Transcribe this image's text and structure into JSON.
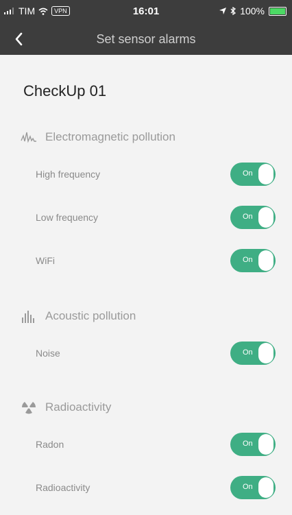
{
  "status_bar": {
    "carrier": "TIM",
    "vpn": "VPN",
    "time": "16:01",
    "battery": "100%"
  },
  "header": {
    "title": "Set sensor alarms"
  },
  "device": {
    "name": "CheckUp 01"
  },
  "sections": {
    "electromagnetic": {
      "title": "Electromagnetic pollution",
      "icon": "waveform-icon",
      "items": [
        {
          "label": "High frequency",
          "toggle": "On"
        },
        {
          "label": "Low frequency",
          "toggle": "On"
        },
        {
          "label": "WiFi",
          "toggle": "On"
        }
      ]
    },
    "acoustic": {
      "title": "Acoustic pollution",
      "icon": "sound-bars-icon",
      "items": [
        {
          "label": "Noise",
          "toggle": "On"
        }
      ]
    },
    "radioactivity": {
      "title": "Radioactivity",
      "icon": "radiation-icon",
      "items": [
        {
          "label": "Radon",
          "toggle": "On"
        },
        {
          "label": "Radioactivity",
          "toggle": "On"
        }
      ]
    }
  },
  "colors": {
    "accent": "#3fae84",
    "bar_background": "#3d3d3d",
    "page_background": "#f3f3f3"
  }
}
